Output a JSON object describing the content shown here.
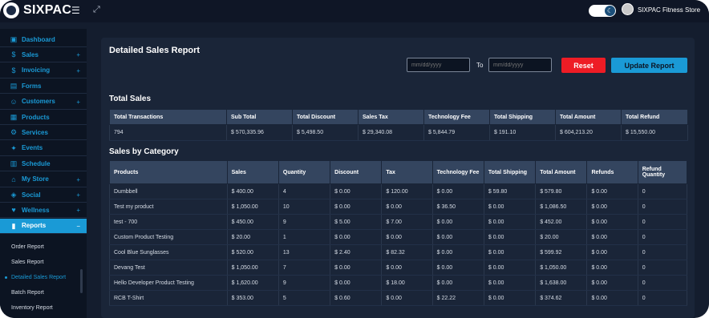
{
  "app": {
    "logo_text": "SIXPAC",
    "store_name": "SIXPAC Fitness Store"
  },
  "sidebar": {
    "items": [
      {
        "label": "Dashboard",
        "icon": "dashboard-icon",
        "glyph": "▣",
        "plus": ""
      },
      {
        "label": "Sales",
        "icon": "dollar-icon",
        "glyph": "$",
        "plus": "+"
      },
      {
        "label": "Invoicing",
        "icon": "invoice-icon",
        "glyph": "$",
        "plus": "+"
      },
      {
        "label": "Forms",
        "icon": "forms-icon",
        "glyph": "▤",
        "plus": ""
      },
      {
        "label": "Customers",
        "icon": "customers-icon",
        "glyph": "☺",
        "plus": "+"
      },
      {
        "label": "Products",
        "icon": "products-icon",
        "glyph": "▦",
        "plus": ""
      },
      {
        "label": "Services",
        "icon": "services-icon",
        "glyph": "⚙",
        "plus": ""
      },
      {
        "label": "Events",
        "icon": "events-icon",
        "glyph": "✦",
        "plus": ""
      },
      {
        "label": "Schedule",
        "icon": "schedule-icon",
        "glyph": "▥",
        "plus": ""
      },
      {
        "label": "My Store",
        "icon": "store-icon",
        "glyph": "⌂",
        "plus": "+"
      },
      {
        "label": "Social",
        "icon": "social-icon",
        "glyph": "◈",
        "plus": "+"
      },
      {
        "label": "Wellness",
        "icon": "wellness-icon",
        "glyph": "♥",
        "plus": "+"
      },
      {
        "label": "Reports",
        "icon": "reports-icon",
        "glyph": "▮",
        "plus": "−"
      }
    ],
    "sub_items": [
      "Order Report",
      "Sales Report",
      "Detailed Sales Report",
      "Batch Report",
      "Inventory Report"
    ]
  },
  "report": {
    "title": "Detailed Sales Report",
    "date_from_placeholder": "mm/dd/yyyy",
    "to_label": "To",
    "date_to_placeholder": "mm/dd/yyyy",
    "reset_label": "Reset",
    "update_label": "Update Report"
  },
  "totals": {
    "title": "Total Sales",
    "headers": [
      "Total Transactions",
      "Sub Total",
      "Total Discount",
      "Sales Tax",
      "Technology Fee",
      "Total Shipping",
      "Total Amount",
      "Total Refund"
    ],
    "row": [
      "794",
      "$ 570,335.96",
      "$ 5,498.50",
      "$ 29,340.08",
      "$ 5,844.79",
      "$ 191.10",
      "$ 604,213.20",
      "$ 15,550.00"
    ]
  },
  "category": {
    "title": "Sales by Category",
    "headers": [
      "Products",
      "Sales",
      "Quantity",
      "Discount",
      "Tax",
      "Technology Fee",
      "Total Shipping",
      "Total Amount",
      "Refunds",
      "Refund Quantity"
    ],
    "rows": [
      [
        "Dumbbell",
        "$ 400.00",
        "4",
        "$ 0.00",
        "$ 120.00",
        "$ 0.00",
        "$ 59.80",
        "$ 579.80",
        "$ 0.00",
        "0"
      ],
      [
        "Test my product",
        "$ 1,050.00",
        "10",
        "$ 0.00",
        "$ 0.00",
        "$ 36.50",
        "$ 0.00",
        "$ 1,086.50",
        "$ 0.00",
        "0"
      ],
      [
        "test - 700",
        "$ 450.00",
        "9",
        "$ 5.00",
        "$ 7.00",
        "$ 0.00",
        "$ 0.00",
        "$ 452.00",
        "$ 0.00",
        "0"
      ],
      [
        "Custom Product Testing",
        "$ 20.00",
        "1",
        "$ 0.00",
        "$ 0.00",
        "$ 0.00",
        "$ 0.00",
        "$ 20.00",
        "$ 0.00",
        "0"
      ],
      [
        "Cool Blue Sunglasses",
        "$ 520.00",
        "13",
        "$ 2.40",
        "$ 82.32",
        "$ 0.00",
        "$ 0.00",
        "$ 599.92",
        "$ 0.00",
        "0"
      ],
      [
        "Devang Test",
        "$ 1,050.00",
        "7",
        "$ 0.00",
        "$ 0.00",
        "$ 0.00",
        "$ 0.00",
        "$ 1,050.00",
        "$ 0.00",
        "0"
      ],
      [
        "Hello Developer Product Testing",
        "$ 1,620.00",
        "9",
        "$ 0.00",
        "$ 18.00",
        "$ 0.00",
        "$ 0.00",
        "$ 1,638.00",
        "$ 0.00",
        "0"
      ],
      [
        "RCB T-Shirt",
        "$ 353.00",
        "5",
        "$ 0.60",
        "$ 0.00",
        "$ 22.22",
        "$ 0.00",
        "$ 374.62",
        "$ 0.00",
        "0"
      ]
    ]
  }
}
